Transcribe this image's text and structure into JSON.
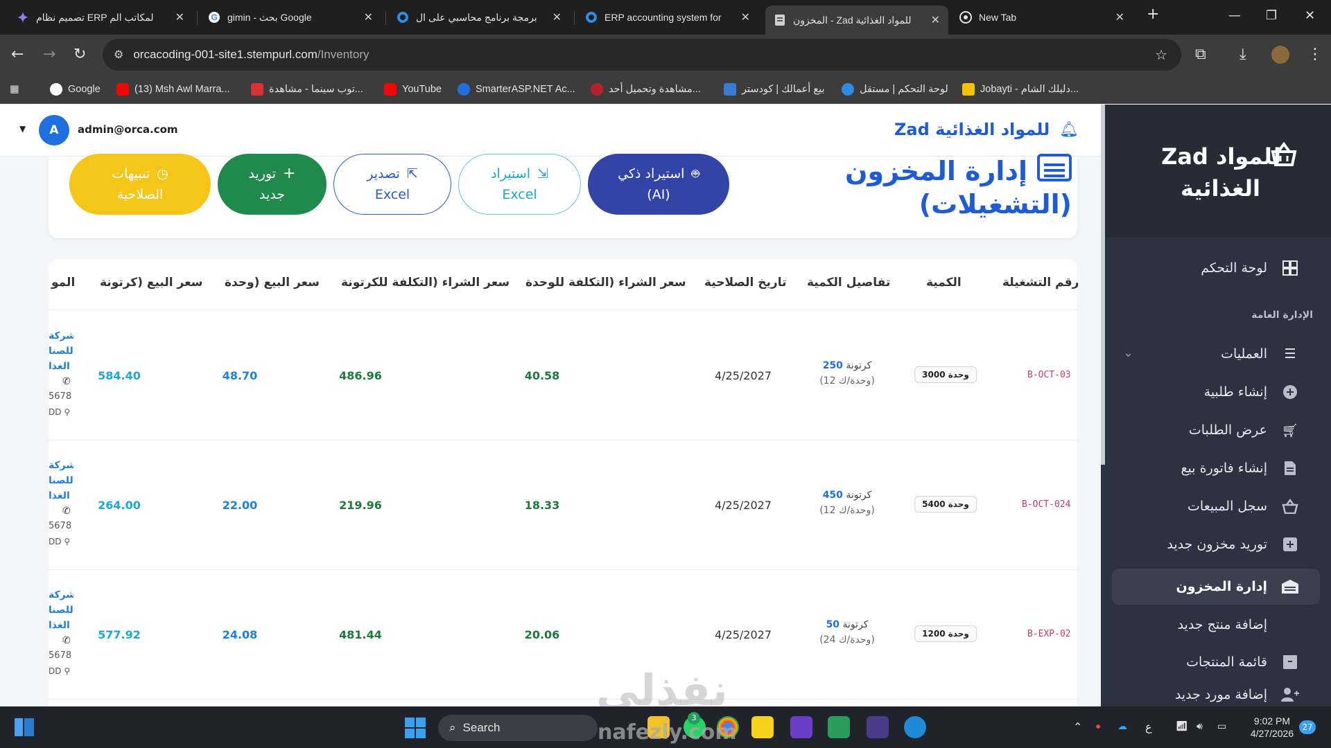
{
  "browser": {
    "tabs": [
      {
        "title": "تصميم نظام ERP لمكاتب الم",
        "fav_color": "#8a7cf7"
      },
      {
        "title": "gimin - بحث Google",
        "fav_color": "#ffffff"
      },
      {
        "title": "برمجة برنامج محاسبي على ال",
        "fav_color": "#2b8de6"
      },
      {
        "title": "ERP accounting system for",
        "fav_color": "#2b8de6"
      },
      {
        "title": "المخزون - Zad للمواد الغذائية",
        "fav_color": "#c9c9c9"
      },
      {
        "title": "New Tab",
        "fav_color": "#e3e3e3"
      }
    ],
    "url_host": "orcacoding-001-site1.stempurl.com",
    "url_path": "/Inventory",
    "bookmarks": [
      {
        "label": "Google",
        "color": "#4285f4"
      },
      {
        "label": "(13) Msh Awl Marra...",
        "color": "#ff0000"
      },
      {
        "label": "توب سينما - مشاهدة...",
        "color": "#d83232"
      },
      {
        "label": "YouTube",
        "color": "#ff0000"
      },
      {
        "label": "SmarterASP.NET Ac...",
        "color": "#1f6fe0"
      },
      {
        "label": "مشاهدة وتحميل أحد...",
        "color": "#b8202c"
      },
      {
        "label": "بيع أعمالك | كودستر",
        "color": "#3a7bd5"
      },
      {
        "label": "لوحة التحكم | مستقل",
        "color": "#2b8de6"
      },
      {
        "label": "Jobayti - دليلك الشام...",
        "color": "#f2c200"
      }
    ]
  },
  "header": {
    "user_email": "admin@orca.com",
    "user_initial": "A",
    "brand": "Zad للمواد الغذائية"
  },
  "sidebar": {
    "brand_line1": "Zad للمواد",
    "brand_line2": "الغذائية",
    "section_label": "الإدارة العامة",
    "items": [
      {
        "label": "لوحة التحكم",
        "icon": "dashboard-icon"
      },
      {
        "label": "العمليات",
        "icon": "list-icon"
      },
      {
        "label": "إنشاء طلبية",
        "icon": "plus-circle-icon"
      },
      {
        "label": "عرض الطلبات",
        "icon": "cart-icon"
      },
      {
        "label": "إنشاء فاتورة بيع",
        "icon": "invoice-icon"
      },
      {
        "label": "سجل المبيعات",
        "icon": "basket-icon"
      },
      {
        "label": "توريد مخزون جديد",
        "icon": "plus-box-icon"
      },
      {
        "label": "إدارة المخزون",
        "icon": "warehouse-icon"
      },
      {
        "label": "إضافة منتج جديد",
        "icon": "add-product-icon"
      },
      {
        "label": "قائمة المنتجات",
        "icon": "box-icon"
      },
      {
        "label": "إضافة مورد جديد",
        "icon": "add-user-icon"
      }
    ]
  },
  "page": {
    "title_line1": "إدارة المخزون",
    "title_line2": "(التشغيلات)",
    "buttons": {
      "ai_import": [
        "استيراد ذكي",
        "(AI)"
      ],
      "import_excel": [
        "استيراد",
        "Excel"
      ],
      "export_excel": [
        "تصدير",
        "Excel"
      ],
      "new_supply": [
        "توريد",
        "جديد"
      ],
      "expiry_alerts": [
        "تنبيهات",
        "الصلاحية"
      ]
    }
  },
  "table": {
    "columns": [
      "رقم التشغيلة",
      "الكمية",
      "تفاصيل الكمية",
      "تاريخ الصلاحية",
      "سعر الشراء (التكلفة للوحدة",
      "سعر الشراء (التكلفة للكرتونة",
      "سعر البيع (وحدة",
      "سعر البيع (كرتونة",
      "المو"
    ],
    "rows": [
      {
        "batch": "B-OCT-03",
        "qty": "3000 وحدة",
        "cartons": "250",
        "carton_word": "كرتونة",
        "per": "(12 وحدة/ك)",
        "expiry": "4/25/2027",
        "cost_unit": "40.58",
        "cost_carton": "486.96",
        "sale_unit": "48.70",
        "sale_carton": "584.40",
        "supplier": [
          "شركة",
          "للصنا",
          "الغذا"
        ],
        "phone": "5678",
        "loc": "DD"
      },
      {
        "batch": "B-OCT-024",
        "qty": "5400 وحدة",
        "cartons": "450",
        "carton_word": "كرتونة",
        "per": "(12 وحدة/ك)",
        "expiry": "4/25/2027",
        "cost_unit": "18.33",
        "cost_carton": "219.96",
        "sale_unit": "22.00",
        "sale_carton": "264.00",
        "supplier": [
          "شركة",
          "للصنا",
          "الغذا"
        ],
        "phone": "5678",
        "loc": "DD"
      },
      {
        "batch": "B-EXP-02",
        "qty": "1200 وحدة",
        "cartons": "50",
        "carton_word": "كرتونة",
        "per": "(24 وحدة/ك)",
        "expiry": "4/25/2027",
        "cost_unit": "20.06",
        "cost_carton": "481.44",
        "sale_unit": "24.08",
        "sale_carton": "577.92",
        "supplier": [
          "شركة",
          "للصنا",
          "الغذا"
        ],
        "phone": "5678",
        "loc": "DD"
      }
    ]
  },
  "taskbar": {
    "search": "Search",
    "time": "9:02 PM",
    "date": "4/27/2026",
    "notif": "27",
    "badge": "3",
    "lang": "ع"
  },
  "watermark": {
    "ar": "نفذلي",
    "en": "nafezly.com"
  }
}
